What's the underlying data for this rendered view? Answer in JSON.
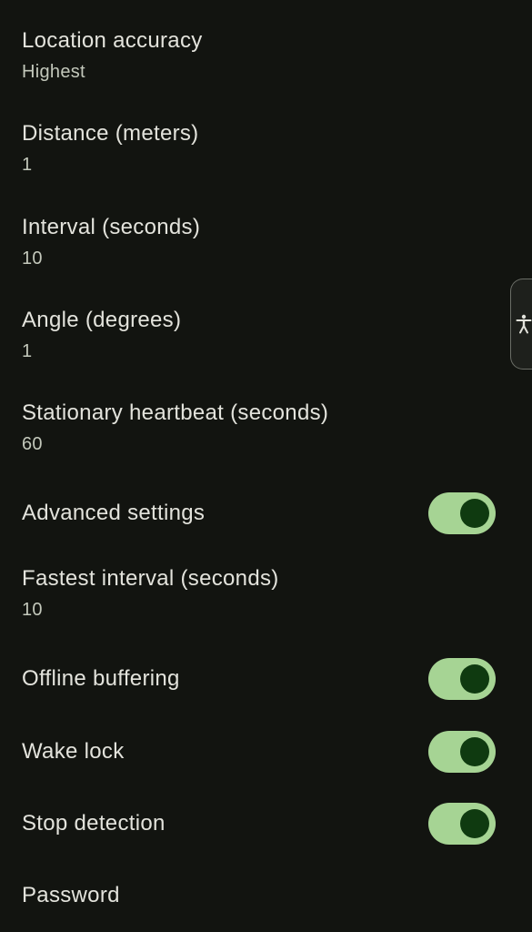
{
  "settings": {
    "location_accuracy": {
      "title": "Location accuracy",
      "summary": "Highest"
    },
    "distance": {
      "title": "Distance (meters)",
      "summary": "1"
    },
    "interval": {
      "title": "Interval (seconds)",
      "summary": "10"
    },
    "angle": {
      "title": "Angle (degrees)",
      "summary": "1"
    },
    "stationary_heartbeat": {
      "title": "Stationary heartbeat (seconds)",
      "summary": "60"
    },
    "advanced_settings": {
      "title": "Advanced settings",
      "enabled": true
    },
    "fastest_interval": {
      "title": "Fastest interval (seconds)",
      "summary": "10"
    },
    "offline_buffering": {
      "title": "Offline buffering",
      "enabled": true
    },
    "wake_lock": {
      "title": "Wake lock",
      "enabled": true
    },
    "stop_detection": {
      "title": "Stop detection",
      "enabled": true
    },
    "password": {
      "title": "Password"
    }
  },
  "colors": {
    "background": "#121410",
    "switch_track_on": "#a6d494",
    "switch_thumb_on": "#0f3a10"
  },
  "icons": {
    "accessibility_button": "accessibility-icon"
  }
}
